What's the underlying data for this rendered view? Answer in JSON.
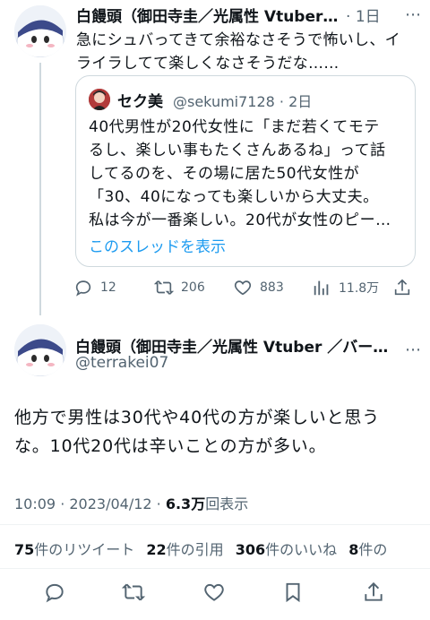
{
  "reply_tweet": {
    "author_name": "白饅頭（御田寺圭／光属性 Vtuber…",
    "time": "1日",
    "text_lines": [
      "急にシュバってきて余裕なさそうで怖いし、イ",
      "ライラしてて楽しくなさそうだな……"
    ],
    "more": "⋯"
  },
  "quoted_tweet": {
    "author_name": "セク美",
    "handle_time": "@sekumi7128 · 2日",
    "text_lines": [
      "40代男性が20代女性に「まだ若くてモテ",
      "るし、楽しい事もたくさんあるね」って話",
      "してるのを、その場に居た50代女性が",
      "「30、40になっても楽しいから大丈夫。",
      "私は今が一番楽しい。20代が女性のピー…"
    ],
    "show_thread": "このスレッドを表示"
  },
  "reply_actions": {
    "replies": "12",
    "retweets": "206",
    "likes": "883",
    "views": "11.8万"
  },
  "main_tweet": {
    "author_name": "白饅頭（御田寺圭／光属性 Vtuber ／バー…",
    "handle": "@terrakei07",
    "more": "⋯",
    "text_lines": [
      "他方で男性は30代や40代の方が楽しいと思う",
      "な。10代20代は辛いことの方が多い。"
    ],
    "timestamp": "10:09 · 2023/04/12 · ",
    "views_count": "6.3万",
    "views_label": "回表示"
  },
  "stats": {
    "retweets_count": "75",
    "retweets_label": "件のリツイート",
    "quotes_count": "22",
    "quotes_label": "件の引用",
    "likes_count": "306",
    "likes_label": "件のいいね",
    "bookmarks_count": "8",
    "bookmarks_label": "件の"
  },
  "icons": {
    "reply": "reply-icon",
    "retweet": "retweet-icon",
    "like": "like-icon",
    "views": "views-icon",
    "share": "share-icon",
    "bookmark": "bookmark-icon"
  },
  "colors": {
    "link": "#1d9bf0",
    "muted": "#536471",
    "text": "#0f1419"
  }
}
